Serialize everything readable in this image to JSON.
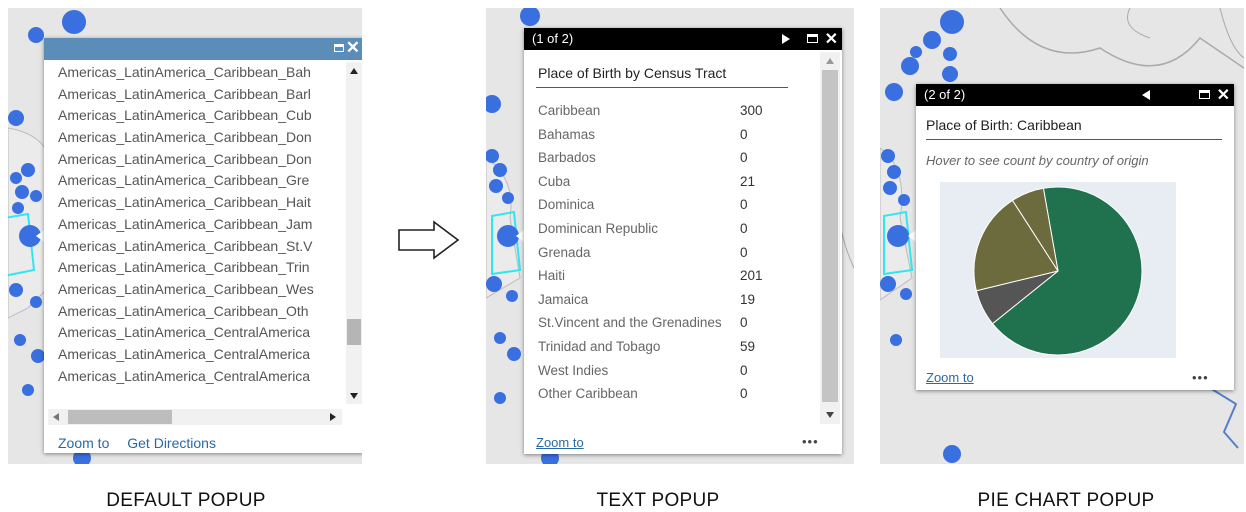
{
  "arrow_icon": "hollow-right-arrow",
  "default_popup": {
    "caption": "DEFAULT POPUP",
    "rows": [
      "Americas_LatinAmerica_Caribbean_Bah",
      "Americas_LatinAmerica_Caribbean_Barl",
      "Americas_LatinAmerica_Caribbean_Cub",
      "Americas_LatinAmerica_Caribbean_Don",
      "Americas_LatinAmerica_Caribbean_Don",
      "Americas_LatinAmerica_Caribbean_Gre",
      "Americas_LatinAmerica_Caribbean_Hait",
      "Americas_LatinAmerica_Caribbean_Jam",
      "Americas_LatinAmerica_Caribbean_St.V",
      "Americas_LatinAmerica_Caribbean_Trin",
      "Americas_LatinAmerica_Caribbean_Wes",
      "Americas_LatinAmerica_Caribbean_Oth",
      "Americas_LatinAmerica_CentralAmerica",
      "Americas_LatinAmerica_CentralAmerica",
      "Americas_LatinAmerica_CentralAmerica"
    ],
    "zoom_label": "Zoom to",
    "directions_label": "Get Directions"
  },
  "text_popup": {
    "caption": "TEXT POPUP",
    "count": "(1 of 2)",
    "title": "Place of Birth by Census Tract",
    "rows": [
      {
        "label": "Caribbean",
        "value": "300"
      },
      {
        "label": "Bahamas",
        "value": "0"
      },
      {
        "label": "Barbados",
        "value": "0"
      },
      {
        "label": "Cuba",
        "value": "21"
      },
      {
        "label": "Dominica",
        "value": "0"
      },
      {
        "label": "Dominican Republic",
        "value": "0"
      },
      {
        "label": "Grenada",
        "value": "0"
      },
      {
        "label": "Haiti",
        "value": "201"
      },
      {
        "label": "Jamaica",
        "value": "19"
      },
      {
        "label": "St.Vincent and the Grenadines",
        "value": "0"
      },
      {
        "label": "Trinidad and Tobago",
        "value": "59"
      },
      {
        "label": "West Indies",
        "value": "0"
      },
      {
        "label": "Other Caribbean",
        "value": "0"
      }
    ],
    "zoom_label": "Zoom to",
    "more_label": "•••"
  },
  "pie_popup": {
    "caption": "PIE CHART POPUP",
    "count": "(2 of 2)",
    "title": "Place of Birth: Caribbean",
    "hint": "Hover to see count by country of origin",
    "zoom_label": "Zoom to",
    "more_label": "•••"
  },
  "chart_data": {
    "type": "pie",
    "title": "",
    "slices": [
      {
        "value": 201,
        "color": "#20714e"
      },
      {
        "value": 21,
        "color": "#555555"
      },
      {
        "value": 59,
        "color": "#6b6b3e"
      },
      {
        "value": 19,
        "color": "#6b6b3e"
      }
    ],
    "start_angle_deg": -10
  },
  "colors": {
    "map_background": "#e6e6e6",
    "point_color": "#3a6fe0",
    "polygon_outline": "#2ee7f0",
    "link_color": "#2a6aa3",
    "popup_header_blue": "#5b8db8"
  }
}
